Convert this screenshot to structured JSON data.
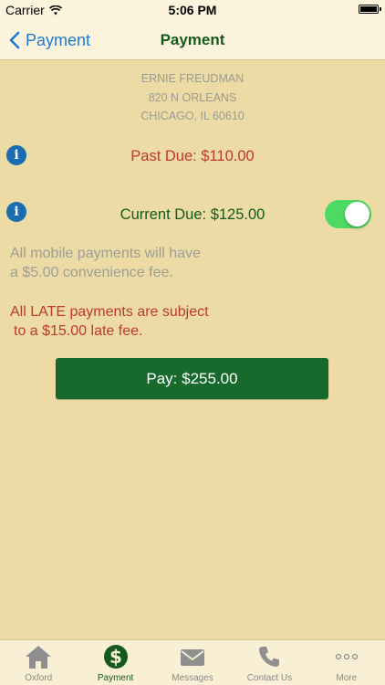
{
  "status_bar": {
    "carrier": "Carrier",
    "time": "5:06 PM"
  },
  "nav": {
    "back_label": "Payment",
    "title": "Payment"
  },
  "address": {
    "name": "ERNIE FREUDMAN",
    "street": "820 N ORLEANS",
    "city": "CHICAGO, IL 60610"
  },
  "dues": {
    "past_due": "Past Due: $110.00",
    "current_due": "Current Due: $125.00",
    "current_due_toggle_on": true
  },
  "notes": {
    "fee_line1": "All mobile payments will have",
    "fee_line2": "a $5.00 convenience fee.",
    "late_line1": "All LATE payments are subject",
    "late_line2": "to a $15.00 late fee."
  },
  "pay_button": {
    "label": "Pay: $255.00"
  },
  "tabs": [
    {
      "label": "Oxford",
      "icon": "home-icon",
      "active": false
    },
    {
      "label": "Payment",
      "icon": "dollar-icon",
      "active": true
    },
    {
      "label": "Messages",
      "icon": "envelope-icon",
      "active": false
    },
    {
      "label": "Contact Us",
      "icon": "phone-icon",
      "active": false
    },
    {
      "label": "More",
      "icon": "more-icon",
      "active": false
    }
  ],
  "colors": {
    "background": "#ecdba4",
    "accent_green": "#145a1c",
    "button_green": "#176a2b",
    "alert_red": "#c1392b",
    "link_blue": "#1e7ad6",
    "toggle_green": "#4cd964"
  }
}
